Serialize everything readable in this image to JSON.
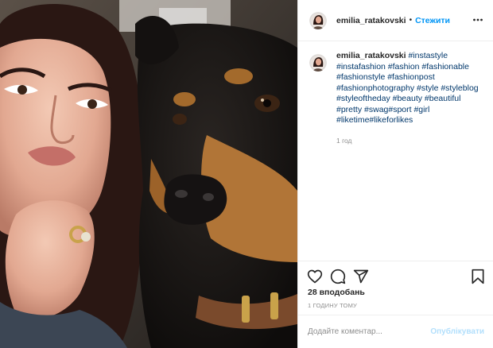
{
  "header": {
    "username": "emilia_ratakovski",
    "separator": "•",
    "follow_label": "Стежити",
    "more_icon": "more-horizontal-icon"
  },
  "caption": {
    "username": "emilia_ratakovski",
    "hashtags": "#instastyle #instafashion #fashion #fashionable #fashionstyle #fashionpost #fashionphotography #style #styleblog #styleoftheday #beauty #beautiful #pretty #swag#sport #girl #liketime#likeforlikes",
    "time_ago": "1 год"
  },
  "actions": {
    "like_icon": "heart-icon",
    "comment_icon": "comment-icon",
    "share_icon": "paper-plane-icon",
    "save_icon": "bookmark-icon"
  },
  "likes_text": "28 вподобань",
  "posted_text": "1 годину тому",
  "comment_box": {
    "placeholder": "Додайте коментар...",
    "publish_label": "Опублікувати"
  },
  "colors": {
    "link_blue": "#0095f6",
    "hashtag": "#00376b",
    "muted": "#8e8e8e",
    "publish_disabled": "#b2dffc"
  }
}
